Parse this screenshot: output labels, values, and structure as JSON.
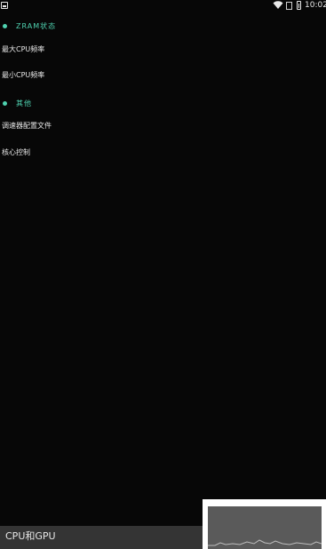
{
  "status_bar": {
    "time": "10:02",
    "icons": [
      "app-icon",
      "wifi-icon",
      "no-sim-icon",
      "battery-icon"
    ]
  },
  "sections": [
    {
      "label": "ZRAM状态"
    },
    {
      "label": "其他"
    }
  ],
  "items": {
    "max_cpu": "最大CPU频率",
    "min_cpu": "最小CPU频率",
    "governor_profile": "调速器配置文件",
    "core_control": "核心控制"
  },
  "bottom_bar": {
    "label": "CPU和GPU"
  },
  "colors": {
    "accent": "#4fd2b0",
    "background": "#070707",
    "bottom_bar": "#343434"
  }
}
